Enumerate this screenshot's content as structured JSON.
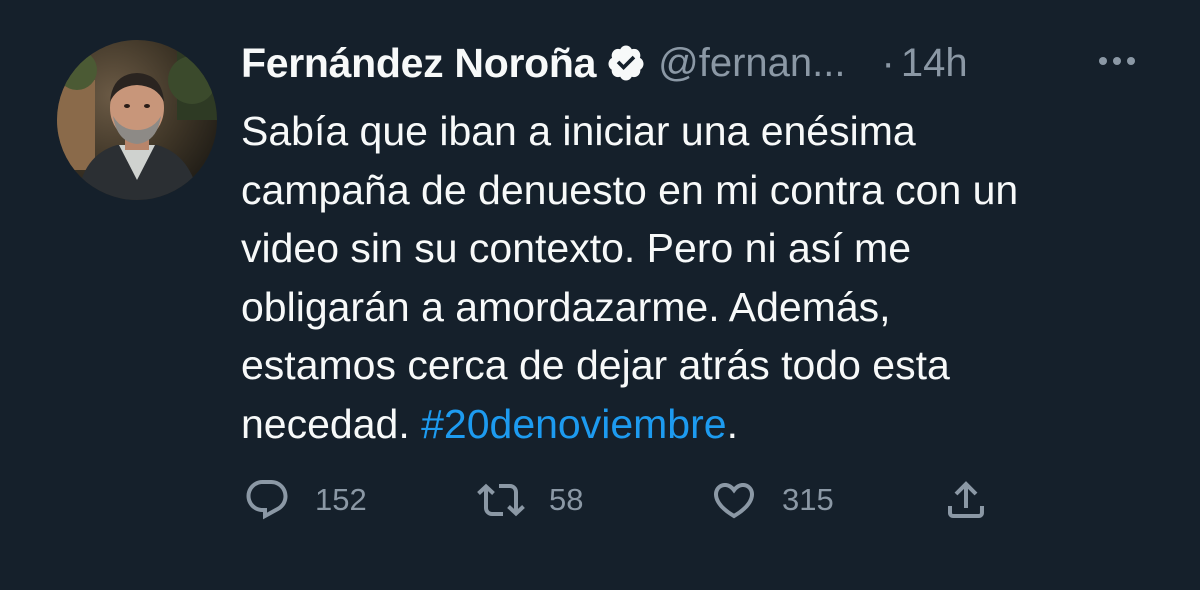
{
  "author": {
    "name": "Fernández Noroña",
    "handle": "@fernan...",
    "time_separator": "·",
    "time": "14h"
  },
  "tweet": {
    "lines": [
      "Sabía que iban a iniciar una enésima",
      "campaña de denuesto en mi contra con un",
      "video sin su contexto. Pero ni así me",
      "obligarán a amordazarme. Además,",
      "estamos cerca de dejar atrás todo esta"
    ],
    "last_line_prefix": "necedad. ",
    "hashtag": "#20denoviembre",
    "last_line_suffix": "."
  },
  "actions": {
    "replies": "152",
    "retweets": "58",
    "likes": "315"
  },
  "icons": {
    "more": "more-icon",
    "reply": "reply-icon",
    "retweet": "retweet-icon",
    "like": "heart-icon",
    "share": "share-icon",
    "verified": "verified-badge-icon"
  },
  "colors": {
    "background": "#15202b",
    "text": "#f7f9f9",
    "secondary": "#8b98a5",
    "link": "#1d9bf0"
  }
}
